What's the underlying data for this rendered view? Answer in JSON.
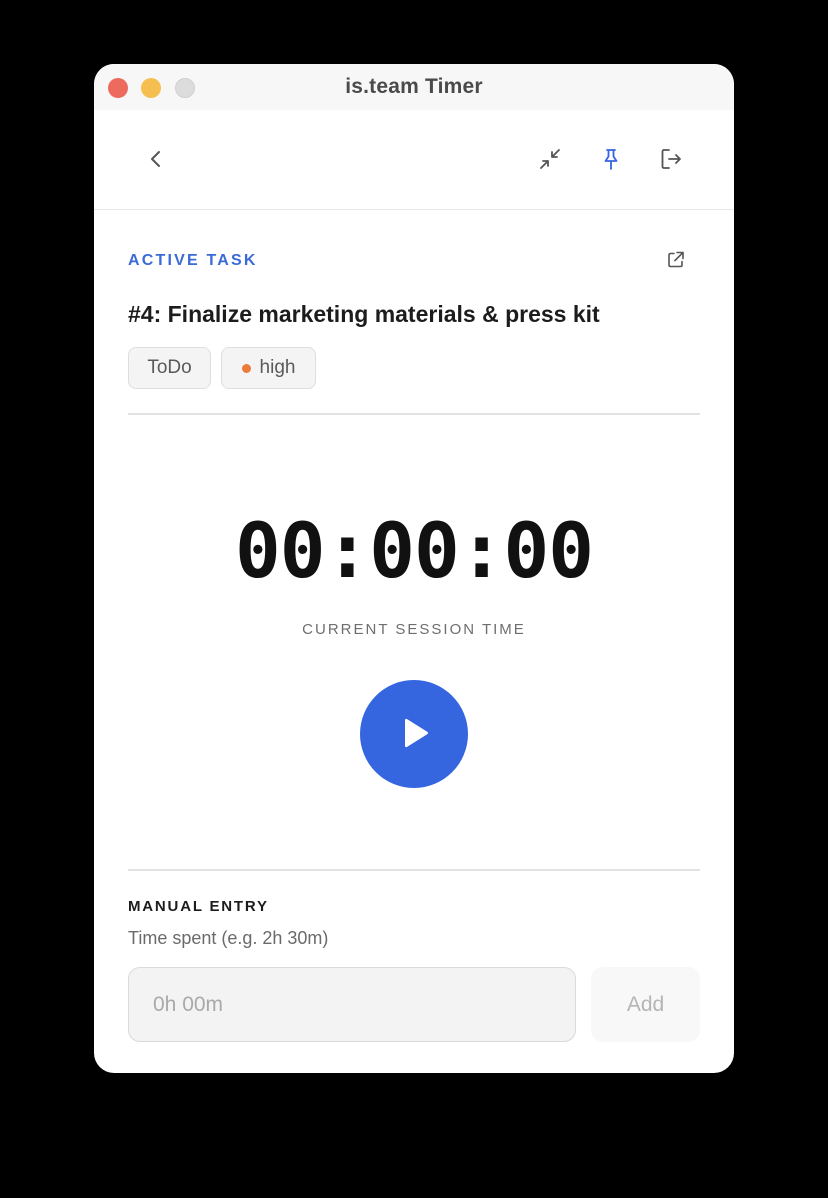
{
  "window": {
    "title": "is.team Timer"
  },
  "toolbar": {
    "back_icon": "chevron-left-icon",
    "collapse_icon": "collapse-arrows-icon",
    "pin_icon": "pin-icon",
    "exit_icon": "log-out-icon"
  },
  "task": {
    "section_label": "ACTIVE TASK",
    "open_external_icon": "external-link-icon",
    "title": "#4: Finalize marketing materials & press kit",
    "status": "ToDo",
    "priority": "high",
    "priority_color": "#ec7a38"
  },
  "timer": {
    "display": "00:00:00",
    "label": "CURRENT SESSION TIME",
    "play_icon": "play-icon",
    "accent_color": "#3566e0"
  },
  "manual_entry": {
    "label": "MANUAL ENTRY",
    "hint": "Time spent (e.g. 2h 30m)",
    "value": "",
    "placeholder": "0h 00m",
    "add_label": "Add"
  }
}
